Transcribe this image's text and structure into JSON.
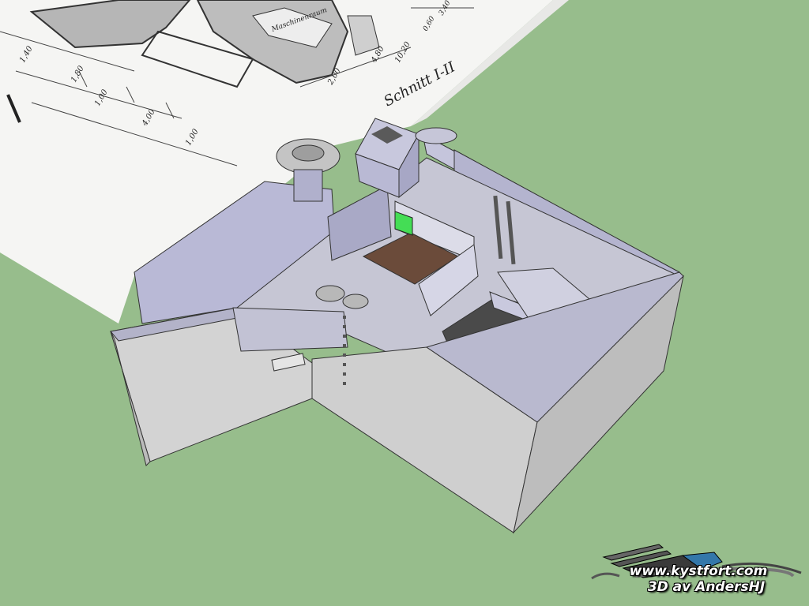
{
  "scene": {
    "description_hidden": "",
    "background_color": "#97bd8c"
  },
  "blueprint": {
    "labels": [
      "Schnitt I-II",
      "Maschinenraum",
      "2,00",
      "10,20",
      "4,80",
      "3,40",
      "0,60",
      "1,40",
      "1,80",
      "1,00",
      "4,00",
      "1,00"
    ]
  },
  "watermark": {
    "site": "www.kystfort.com",
    "credit": "3D av AndersHJ"
  }
}
